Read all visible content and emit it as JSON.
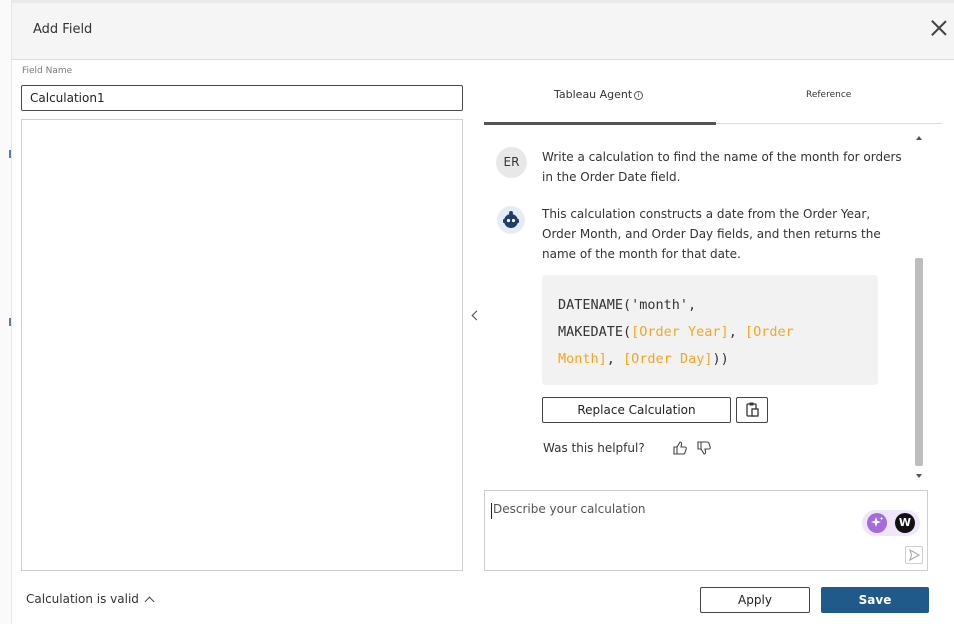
{
  "dialog": {
    "title": "Add Field"
  },
  "field": {
    "label": "Field Name",
    "value": "Calculation1"
  },
  "status": {
    "text": "Calculation is valid"
  },
  "tabs": [
    {
      "label": "Tableau Agent",
      "active": true
    },
    {
      "label": "Reference",
      "active": false
    }
  ],
  "chat": {
    "user_initials": "ER",
    "user_message": "Write a calculation to find the name of the month for orders in the Order Date field.",
    "agent_message": "This calculation constructs a date from the Order Year, Order Month, and Order Day fields, and then returns the name of the month for that date.",
    "code": {
      "line1": "DATENAME('month',",
      "line2_fn": "MAKEDATE(",
      "field1": "[Order Year]",
      "sep1": ", ",
      "field2a": "[Order",
      "field2b": "Month]",
      "sep2": ", ",
      "field3": "[Order Day]",
      "close": "))"
    },
    "replace_label": "Replace Calculation",
    "helpful_label": "Was this helpful?"
  },
  "prompt": {
    "placeholder": "Describe your calculation",
    "w_logo": "W"
  },
  "footer": {
    "apply_label": "Apply",
    "save_label": "Save"
  },
  "colors": {
    "field_ref": "#f5a623",
    "save_button": "#1f5a8a"
  }
}
